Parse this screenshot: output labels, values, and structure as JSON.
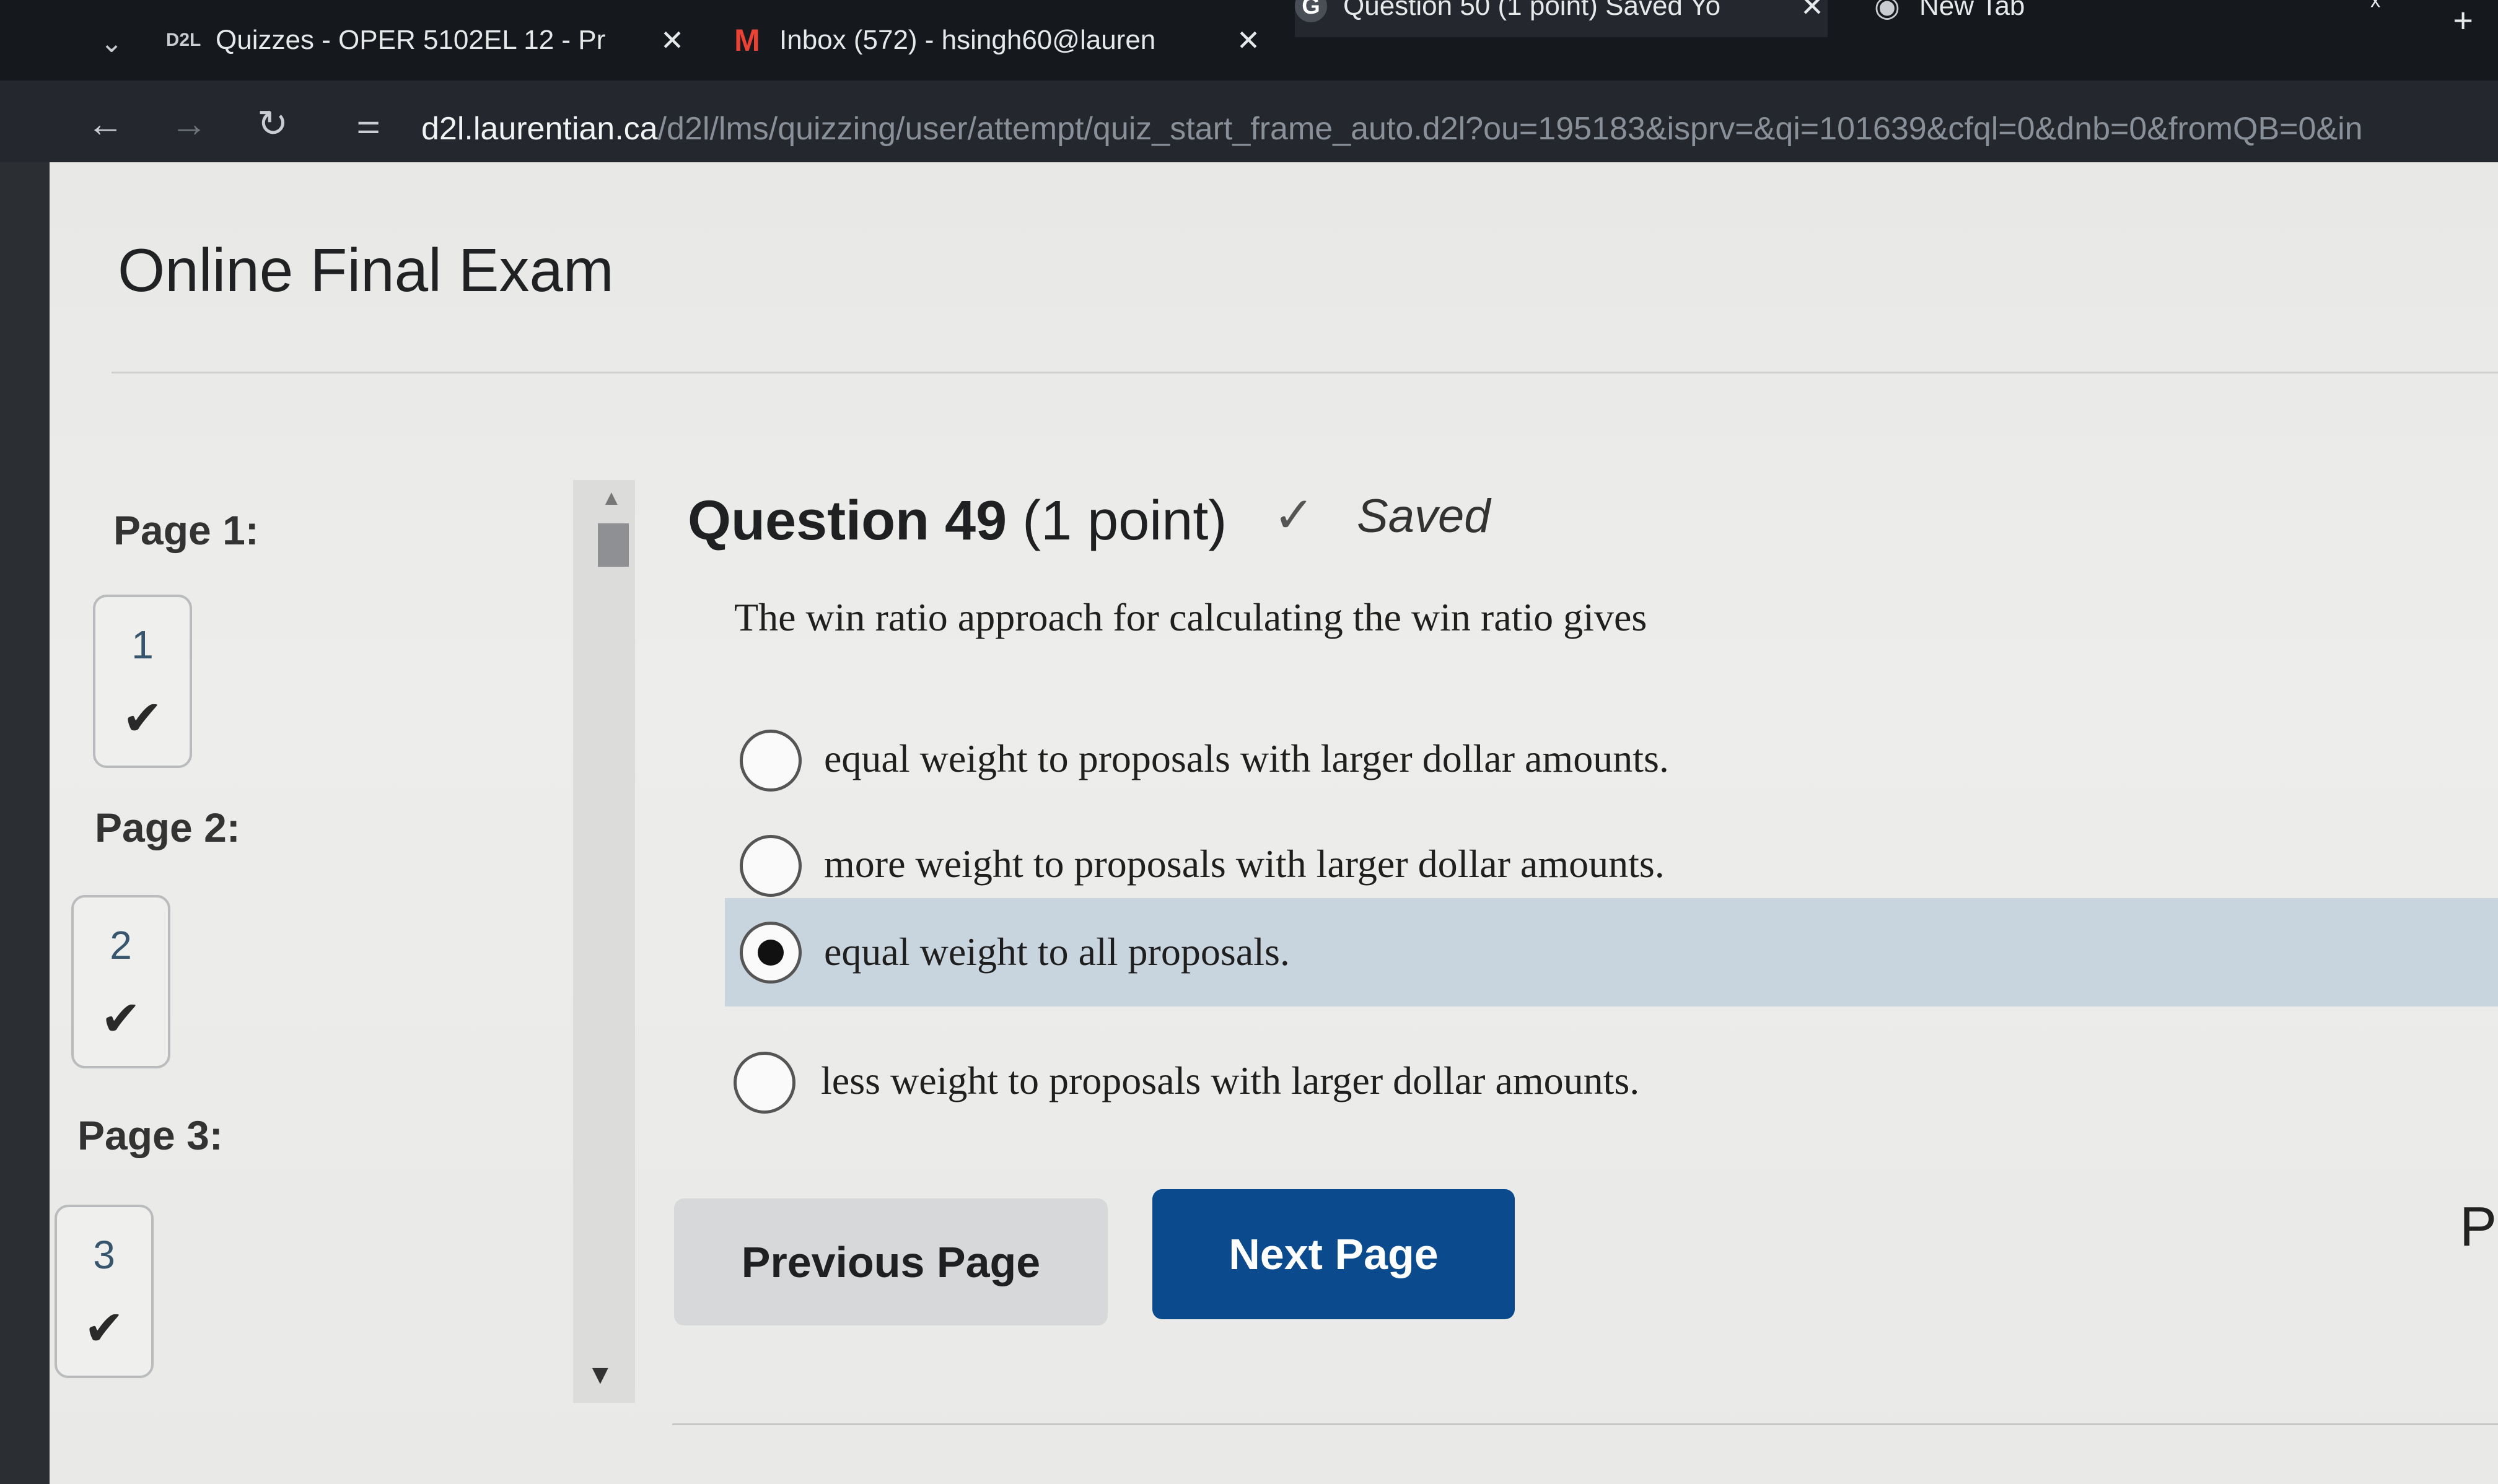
{
  "browser": {
    "tabs": [
      {
        "icon": "d2l-icon",
        "icon_text": "D2L",
        "label": "Quizzes - OPER 5102EL 12 - Pr",
        "close": "✕"
      },
      {
        "icon": "gmail-icon",
        "icon_text": "M",
        "label": "Inbox (572) - hsingh60@lauren",
        "close": "✕"
      },
      {
        "icon": "google-icon",
        "icon_text": "G",
        "label": "Question 50 (1 point) Saved Yo",
        "close": "✕"
      },
      {
        "icon": "chrome-icon",
        "icon_text": "◉",
        "label": "New Tab"
      }
    ],
    "url_host": "d2l.laurentian.ca",
    "url_path": "/d2l/lms/quizzing/user/attempt/quiz_start_frame_auto.d2l?ou=195183&isprv=&qi=101639&cfql=0&dnb=0&fromQB=0&in"
  },
  "exam": {
    "title": "Online Final Exam"
  },
  "sidebar": {
    "pages": [
      {
        "label": "Page 1:",
        "question": "1",
        "check": "✔"
      },
      {
        "label": "Page 2:",
        "question": "2",
        "check": "✔"
      },
      {
        "label": "Page 3:",
        "question": "3",
        "check": "✔"
      }
    ]
  },
  "question": {
    "number_label": "Question 49",
    "points": "(1 point)",
    "status": "Saved",
    "text": "The win ratio approach for calculating the win ratio gives",
    "options": [
      {
        "text": "equal weight to proposals with larger dollar amounts.",
        "selected": false
      },
      {
        "text": "more weight to proposals with larger dollar amounts.",
        "selected": false
      },
      {
        "text": "equal weight to all proposals.",
        "selected": true
      },
      {
        "text": "less weight to proposals with larger dollar amounts.",
        "selected": false
      }
    ]
  },
  "buttons": {
    "previous": "Previous Page",
    "next": "Next Page"
  },
  "partial_text": "P",
  "colors": {
    "next_button": "#0b4a8c",
    "selected_option_bg": "#c9d5de"
  }
}
